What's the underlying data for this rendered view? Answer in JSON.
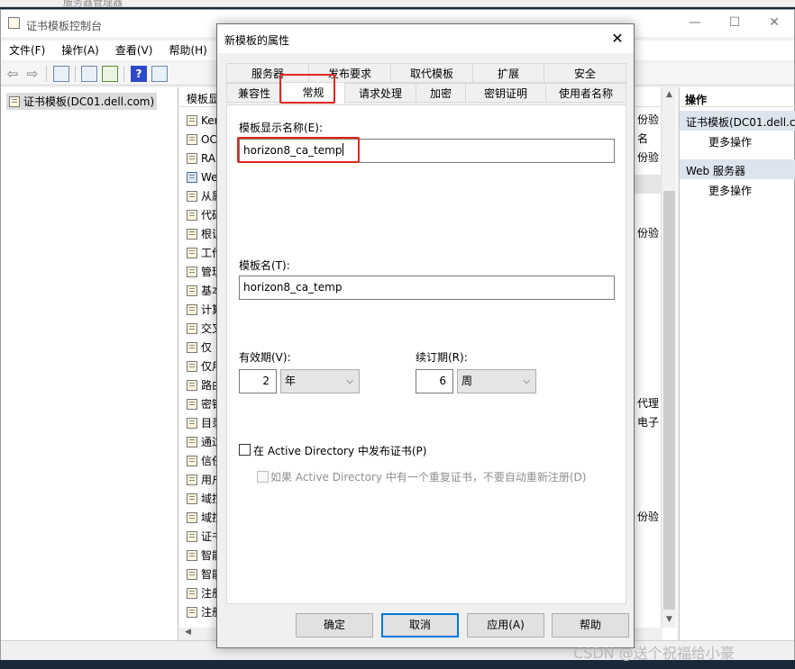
{
  "background_app": {
    "title": "服务器管理器"
  },
  "console": {
    "title": "证书模板控制台",
    "menu": [
      "文件(F)",
      "操作(A)",
      "查看(V)",
      "帮助(H)"
    ],
    "tree_root": "证书模板(DC01.dell.com)",
    "list_header": "模板显",
    "list_rows": [
      "Ker",
      "OC",
      "RA",
      "We",
      "从属",
      "代码",
      "根证",
      "工作",
      "管理",
      "基本",
      "计算",
      "交叉",
      "仅",
      "仅用",
      "路由",
      "密钥",
      "目录",
      "通过",
      "信任",
      "用户",
      "域控",
      "域控",
      "证书",
      "智能",
      "智能",
      "注册",
      "注册"
    ],
    "list_right": [
      {
        "row": 0,
        "text": "份验"
      },
      {
        "row": 1,
        "text": "名"
      },
      {
        "row": 2,
        "text": "份验"
      },
      {
        "row": 6,
        "text": "份验"
      },
      {
        "row": 15,
        "text": "代理"
      },
      {
        "row": 16,
        "text": "电子"
      },
      {
        "row": 21,
        "text": "份验"
      }
    ],
    "actions": {
      "header": "操作",
      "sections": [
        {
          "title": "证书模板(DC01.dell.com)",
          "item": "更多操作"
        },
        {
          "title": "Web 服务器",
          "item": "更多操作"
        }
      ]
    }
  },
  "dialog": {
    "title": "新模板的属性",
    "tabs_row1": [
      "服务器",
      "发布要求",
      "取代模板",
      "扩展",
      "安全"
    ],
    "tabs_row2": [
      "兼容性",
      "常规",
      "请求处理",
      "加密",
      "密钥证明",
      "使用者名称"
    ],
    "active_tab": "常规",
    "display_name_label": "模板显示名称(E):",
    "display_name_value": "horizon8_ca_temp",
    "template_name_label": "模板名(T):",
    "template_name_value": "horizon8_ca_temp",
    "validity_label": "有效期(V):",
    "validity_value": "2",
    "validity_unit": "年",
    "renewal_label": "续订期(R):",
    "renewal_value": "6",
    "renewal_unit": "周",
    "publish_ad_label": "在 Active Directory 中发布证书(P)",
    "publish_ad_checked": false,
    "no_reenroll_label": "如果 Active Directory 中有一个重复证书，不要自动重新注册(D)",
    "buttons": [
      "确定",
      "取消",
      "应用(A)",
      "帮助"
    ]
  },
  "watermark": "CSDN @送个祝福给小豪",
  "highlight_color": "#e0271f"
}
